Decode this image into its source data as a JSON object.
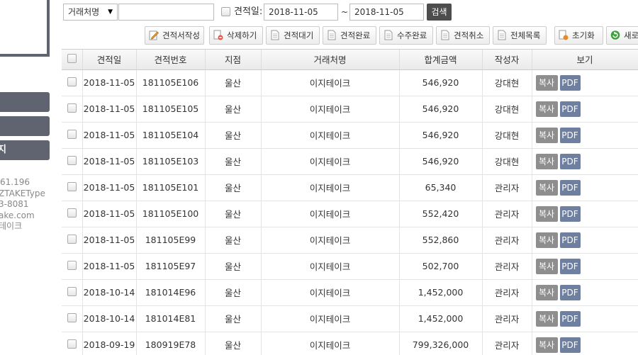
{
  "sidebar": {
    "menu_items": [
      {
        "label": ""
      },
      {
        "label": ""
      },
      {
        "label": "지"
      }
    ],
    "info_lines": [
      "61.196",
      "ZTAKEType",
      "3-8081",
      "ake.com",
      "테이크"
    ]
  },
  "search": {
    "field_select": "거래처명",
    "keyword_value": "",
    "date_checkbox_label": "견적일:",
    "date_from": "2018-11-05",
    "date_separator": "~",
    "date_to": "2018-11-05",
    "search_button": "검색"
  },
  "toolbar": {
    "buttons": [
      {
        "label": "견적서작성",
        "icon": "pencil-icon"
      },
      {
        "label": "삭제하기",
        "icon": "delete-doc-icon"
      },
      {
        "label": "견적대기",
        "icon": "document-icon"
      },
      {
        "label": "견적완료",
        "icon": "document-icon"
      },
      {
        "label": "수주완료",
        "icon": "document-icon"
      },
      {
        "label": "견적취소",
        "icon": "document-icon"
      },
      {
        "label": "전체목록",
        "icon": "document-icon"
      },
      {
        "label": "초기화",
        "icon": "reset-icon"
      },
      {
        "label": "새로",
        "icon": "refresh-icon"
      }
    ]
  },
  "table": {
    "columns": [
      "",
      "견적일",
      "견적번호",
      "지점",
      "거래처명",
      "합계금액",
      "작성자",
      "보기"
    ],
    "copy_label": "복사",
    "pdf_label": "PDF",
    "rows": [
      {
        "date": "2018-11-05",
        "no": "181105E106",
        "branch": "울산",
        "client": "이지테이크",
        "amount": "546,920",
        "writer": "강대현"
      },
      {
        "date": "2018-11-05",
        "no": "181105E105",
        "branch": "울산",
        "client": "이지테이크",
        "amount": "546,920",
        "writer": "강대현"
      },
      {
        "date": "2018-11-05",
        "no": "181105E104",
        "branch": "울산",
        "client": "이지테이크",
        "amount": "546,920",
        "writer": "강대현"
      },
      {
        "date": "2018-11-05",
        "no": "181105E103",
        "branch": "울산",
        "client": "이지테이크",
        "amount": "546,920",
        "writer": "강대현"
      },
      {
        "date": "2018-11-05",
        "no": "181105E101",
        "branch": "울산",
        "client": "이지테이크",
        "amount": "65,340",
        "writer": "관리자"
      },
      {
        "date": "2018-11-05",
        "no": "181105E100",
        "branch": "울산",
        "client": "이지테이크",
        "amount": "552,420",
        "writer": "관리자"
      },
      {
        "date": "2018-11-05",
        "no": "181105E99",
        "branch": "울산",
        "client": "이지테이크",
        "amount": "552,860",
        "writer": "관리자"
      },
      {
        "date": "2018-11-05",
        "no": "181105E97",
        "branch": "울산",
        "client": "이지테이크",
        "amount": "502,700",
        "writer": "관리자"
      },
      {
        "date": "2018-10-14",
        "no": "181014E96",
        "branch": "울산",
        "client": "이지테이크",
        "amount": "1,452,000",
        "writer": "관리자"
      },
      {
        "date": "2018-10-14",
        "no": "181014E81",
        "branch": "울산",
        "client": "이지테이크",
        "amount": "1,452,000",
        "writer": "관리자"
      },
      {
        "date": "2018-09-19",
        "no": "180919E78",
        "branch": "울산",
        "client": "이지테이크",
        "amount": "799,326,000",
        "writer": "관리자"
      }
    ]
  }
}
